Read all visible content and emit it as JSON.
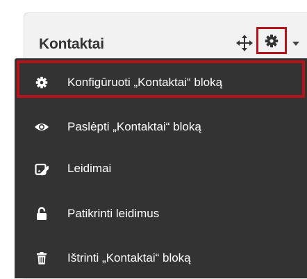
{
  "block": {
    "title": "Kontaktai"
  },
  "header_icons": {
    "move": "move-icon",
    "gear": "gear-icon",
    "caret": "caret-down-icon"
  },
  "menu": {
    "items": [
      {
        "label": "Konfigūruoti „Kontaktai“ bloką",
        "icon": "gear-icon",
        "highlighted": true
      },
      {
        "label": "Paslėpti „Kontaktai“ bloką",
        "icon": "eye-icon"
      },
      {
        "label": "Leidimai",
        "icon": "edit-icon"
      },
      {
        "label": "Patikrinti leidimus",
        "icon": "unlock-icon"
      },
      {
        "label": "Ištrinti „Kontaktai“ bloką",
        "icon": "trash-icon"
      }
    ]
  },
  "colors": {
    "menu_bg": "#333333",
    "highlight": "#b5121b",
    "panel_bg": "#f2f2f2"
  }
}
